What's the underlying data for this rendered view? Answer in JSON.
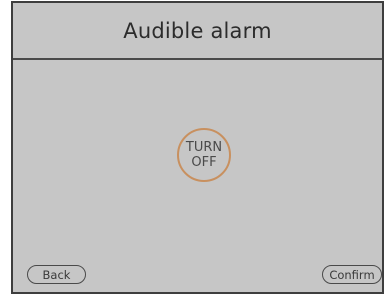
{
  "header": {
    "title": "Audible alarm"
  },
  "toggle": {
    "line1": "TURN",
    "line2": "OFF"
  },
  "footer": {
    "back_label": "Back",
    "confirm_label": "Confirm"
  },
  "colors": {
    "background": "#c6c6c6",
    "toggle_ring": "#c8905f",
    "border": "#3e3e3e"
  }
}
